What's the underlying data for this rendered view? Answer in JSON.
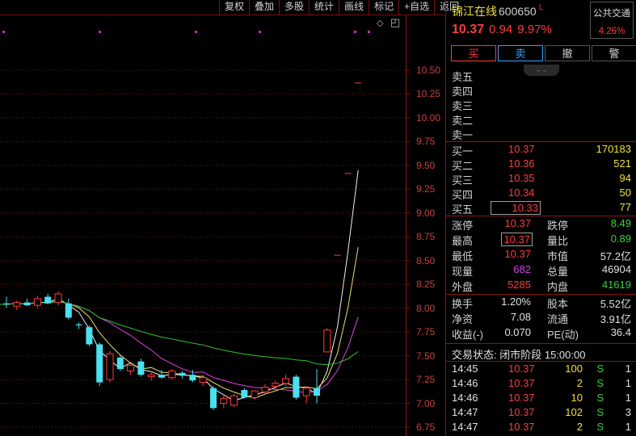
{
  "toolbar": [
    "复权",
    "叠加",
    "多股",
    "统计",
    "画线",
    "标记",
    "+自选",
    "返回"
  ],
  "chart_data": {
    "type": "candlestick",
    "y_ticks": [
      "10.50",
      "10.25",
      "10.00",
      "9.75",
      "9.50",
      "9.25",
      "9.00",
      "8.75",
      "8.50",
      "8.25",
      "8.00",
      "7.75",
      "7.50",
      "7.25",
      "7.00",
      "6.75"
    ],
    "ylim": [
      6.75,
      10.5
    ],
    "candles": [
      {
        "o": 8.05,
        "h": 8.12,
        "l": 8.0,
        "c": 8.04
      },
      {
        "o": 8.02,
        "h": 8.08,
        "l": 7.98,
        "c": 8.06
      },
      {
        "o": 8.06,
        "h": 8.1,
        "l": 8.02,
        "c": 8.03
      },
      {
        "o": 8.03,
        "h": 8.13,
        "l": 8.0,
        "c": 8.1
      },
      {
        "o": 8.12,
        "h": 8.15,
        "l": 8.04,
        "c": 8.05
      },
      {
        "o": 8.06,
        "h": 8.18,
        "l": 8.03,
        "c": 8.15
      },
      {
        "o": 8.05,
        "h": 8.1,
        "l": 7.88,
        "c": 7.9
      },
      {
        "o": 7.83,
        "h": 7.85,
        "l": 7.78,
        "c": 7.82
      },
      {
        "o": 7.8,
        "h": 7.82,
        "l": 7.6,
        "c": 7.62
      },
      {
        "o": 7.62,
        "h": 7.64,
        "l": 7.18,
        "c": 7.22
      },
      {
        "o": 7.25,
        "h": 7.55,
        "l": 7.22,
        "c": 7.52
      },
      {
        "o": 7.48,
        "h": 7.5,
        "l": 7.34,
        "c": 7.36
      },
      {
        "o": 7.34,
        "h": 7.42,
        "l": 7.3,
        "c": 7.4
      },
      {
        "o": 7.44,
        "h": 7.47,
        "l": 7.28,
        "c": 7.3
      },
      {
        "o": 7.28,
        "h": 7.34,
        "l": 7.24,
        "c": 7.3
      },
      {
        "o": 7.3,
        "h": 7.35,
        "l": 7.26,
        "c": 7.27
      },
      {
        "o": 7.27,
        "h": 7.36,
        "l": 7.25,
        "c": 7.34
      },
      {
        "o": 7.32,
        "h": 7.34,
        "l": 7.26,
        "c": 7.29
      },
      {
        "o": 7.3,
        "h": 7.35,
        "l": 7.22,
        "c": 7.24
      },
      {
        "o": 7.22,
        "h": 7.3,
        "l": 7.18,
        "c": 7.27
      },
      {
        "o": 7.16,
        "h": 7.18,
        "l": 6.93,
        "c": 6.95
      },
      {
        "o": 7.0,
        "h": 7.08,
        "l": 6.95,
        "c": 7.05
      },
      {
        "o": 6.98,
        "h": 7.1,
        "l": 6.96,
        "c": 7.08
      },
      {
        "o": 7.14,
        "h": 7.16,
        "l": 7.05,
        "c": 7.06
      },
      {
        "o": 7.06,
        "h": 7.14,
        "l": 7.04,
        "c": 7.13
      },
      {
        "o": 7.12,
        "h": 7.2,
        "l": 7.1,
        "c": 7.17
      },
      {
        "o": 7.18,
        "h": 7.24,
        "l": 7.12,
        "c": 7.21
      },
      {
        "o": 7.21,
        "h": 7.3,
        "l": 7.18,
        "c": 7.26
      },
      {
        "o": 7.28,
        "h": 7.3,
        "l": 7.04,
        "c": 7.06
      },
      {
        "o": 7.08,
        "h": 7.18,
        "l": 7.0,
        "c": 7.16
      },
      {
        "o": 7.16,
        "h": 7.36,
        "l": 7.0,
        "c": 7.08
      },
      {
        "o": 7.54,
        "h": 7.79,
        "l": 7.54,
        "c": 7.77
      },
      {
        "o": 8.56,
        "h": 8.56,
        "l": 8.56,
        "c": 8.56
      },
      {
        "o": 9.42,
        "h": 9.42,
        "l": 9.42,
        "c": 9.42
      },
      {
        "o": 10.37,
        "h": 10.37,
        "l": 10.37,
        "c": 10.37
      }
    ],
    "ma_colors": {
      "white": "#f0f0f0",
      "yellow": "#e8e070",
      "magenta": "#e040e0",
      "green": "#30c030"
    }
  },
  "quote": {
    "name": "锦江在线",
    "code": "600650",
    "flag": "L",
    "sector": "公共交通",
    "sector_pct": "4.26%",
    "price": "10.37",
    "change": "0.94",
    "pct": "9.97%"
  },
  "buttons": {
    "buy": "买",
    "sell": "卖",
    "cancel": "撤",
    "alert": "警"
  },
  "asks": [
    {
      "label": "卖五"
    },
    {
      "label": "卖四"
    },
    {
      "label": "卖三"
    },
    {
      "label": "卖二"
    },
    {
      "label": "卖一"
    }
  ],
  "bids": [
    {
      "label": "买一",
      "price": "10.37",
      "vol": "170183"
    },
    {
      "label": "买二",
      "price": "10.36",
      "vol": "521"
    },
    {
      "label": "买三",
      "price": "10.35",
      "vol": "94"
    },
    {
      "label": "买四",
      "price": "10.34",
      "vol": "50"
    },
    {
      "label": "买五",
      "price": "10.33",
      "vol": "77"
    }
  ],
  "stats": {
    "zhangting_l": "涨停",
    "zhangting": "10.37",
    "dieting_l": "跌停",
    "dieting": "8.49",
    "high_l": "最高",
    "high": "10.37",
    "liangbi_l": "量比",
    "liangbi": "0.89",
    "low_l": "最低",
    "low": "10.37",
    "shizhi_l": "市值",
    "shizhi": "57.2亿",
    "xianliang_l": "现量",
    "xianliang": "682",
    "zongliang_l": "总量",
    "zongliang": "46904",
    "waipan_l": "外盘",
    "waipan": "5285",
    "neipan_l": "内盘",
    "neipan": "41619",
    "huanshou_l": "换手",
    "huanshou": "1.20%",
    "guben_l": "股本",
    "guben": "5.52亿",
    "jingzi_l": "净资",
    "jingzi": "7.08",
    "liutong_l": "流通",
    "liutong": "3.91亿",
    "shouyi_l": "收益(-)",
    "shouyi": "0.070",
    "pe_l": "PE(动)",
    "pe": "36.4"
  },
  "status": "交易状态: 闭市阶段 15:00:00",
  "ticks": [
    {
      "time": "14:45",
      "price": "10.37",
      "vol": "100",
      "side": "S",
      "n": "1"
    },
    {
      "time": "14:46",
      "price": "10.37",
      "vol": "2",
      "side": "S",
      "n": "1"
    },
    {
      "time": "14:46",
      "price": "10.37",
      "vol": "10",
      "side": "S",
      "n": "1"
    },
    {
      "time": "14:47",
      "price": "10.37",
      "vol": "102",
      "side": "S",
      "n": "3"
    },
    {
      "time": "14:47",
      "price": "10.37",
      "vol": "2",
      "side": "S",
      "n": "1"
    }
  ]
}
